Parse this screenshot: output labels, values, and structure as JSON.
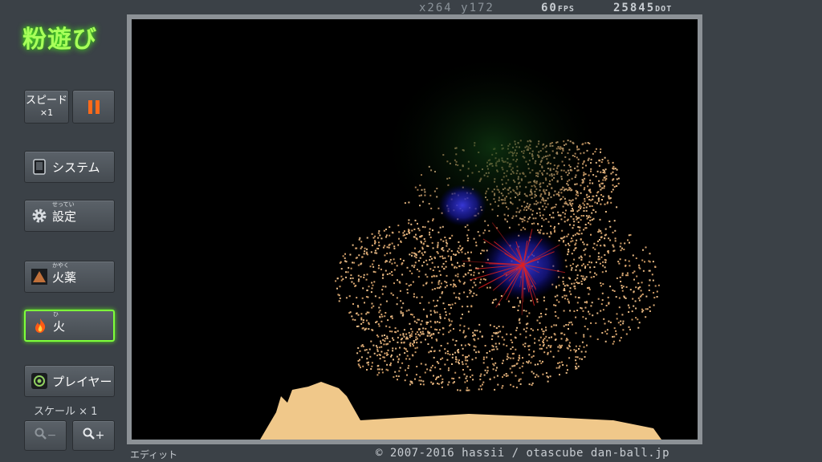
{
  "app": {
    "title": "粉遊び"
  },
  "hud": {
    "coords": "x264 y172",
    "fps_value": "60",
    "fps_unit": "FPS",
    "dots_value": "25845",
    "dots_unit": "DOT"
  },
  "controls": {
    "speed_label_1": "スピード",
    "speed_label_2": "×1",
    "system_label": "システム",
    "settings_label": "設定",
    "settings_ruby": "せってい",
    "gunpowder_label": "火薬",
    "gunpowder_ruby": "かやく",
    "fire_label": "火",
    "fire_ruby": "ひ",
    "player_label": "プレイヤー",
    "scale_label": "スケール × 1",
    "zoom_out_label": "−",
    "zoom_in_label": "+"
  },
  "footer": {
    "edit_label": "エディット",
    "copyright": "© 2007-2016 hassii / otascube dan-ball.jp"
  },
  "colors": {
    "accent": "#a8ff5a",
    "pause": "#ff6a1a",
    "powder": "#e0b07a",
    "sand": "#f0c88a"
  }
}
